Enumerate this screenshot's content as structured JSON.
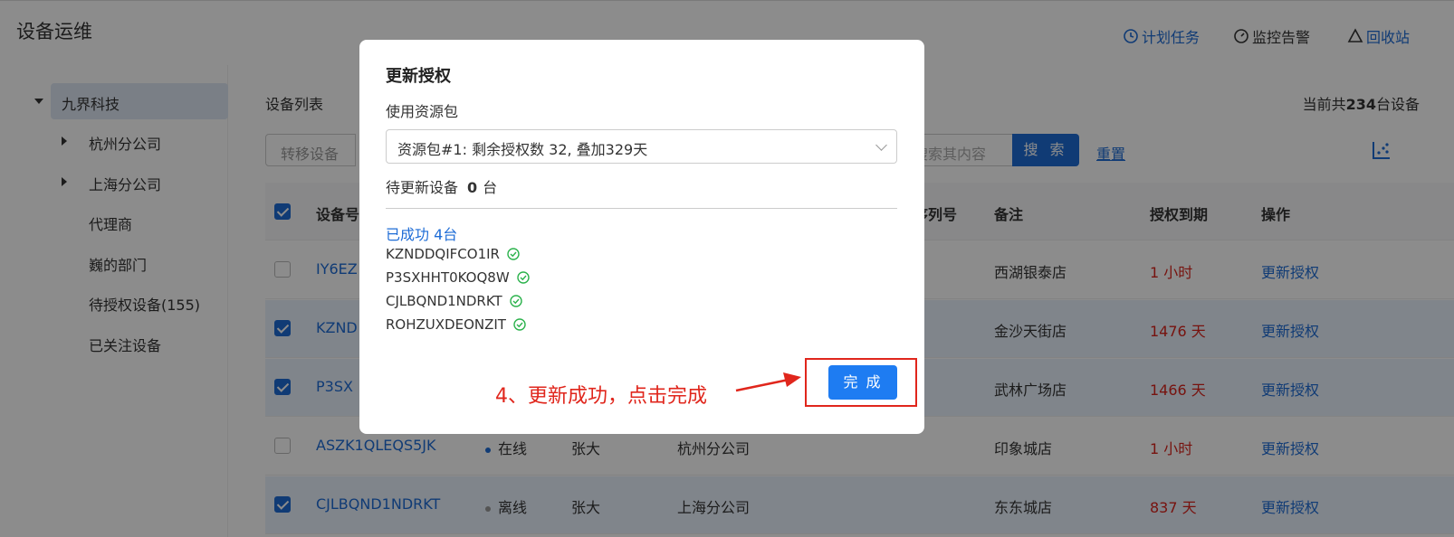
{
  "app": {
    "title": "设备运维",
    "links": [
      {
        "label": "计划任务",
        "icon": "clock-icon"
      },
      {
        "label": "监控告警",
        "icon": "gauge-icon"
      },
      {
        "label": "回收站",
        "icon": "recycle-icon"
      }
    ]
  },
  "sidebar": {
    "root": "九界科技",
    "items": [
      "杭州分公司",
      "上海分公司",
      "代理商",
      "巍的部门",
      "待授权设备(155)",
      "已关注设备"
    ]
  },
  "main": {
    "list_title": "设备列表",
    "total_prefix": "当前共",
    "total_count": "234",
    "total_suffix": "台设备",
    "search_left_placeholder": "转移设备",
    "search_right_placeholder": "牛搜索其内容",
    "search_button": "搜 索",
    "reset_link": "重置",
    "columns": {
      "device": "设备号",
      "serial": "仪序列号",
      "note": "备注",
      "expiry": "授权到期",
      "action": "操作"
    },
    "rows": [
      {
        "device": "IY6EZ",
        "status": "",
        "owner": "",
        "org": "",
        "note": "西湖银泰店",
        "expiry": "1 小时",
        "action": "更新授权",
        "checked": false
      },
      {
        "device": "KZND",
        "status": "",
        "owner": "",
        "org": "",
        "note": "金沙天街店",
        "expiry": "1476 天",
        "action": "更新授权",
        "checked": true
      },
      {
        "device": "P3SX",
        "status": "",
        "owner": "",
        "org": "",
        "note": "武林广场店",
        "expiry": "1466 天",
        "action": "更新授权",
        "checked": true
      },
      {
        "device": "ASZK1QLEQS5JK",
        "status": "在线",
        "status_color": "#1e6cd6",
        "owner": "张大",
        "org": "杭州分公司",
        "note": "印象城店",
        "expiry": "1 小时",
        "action": "更新授权",
        "checked": false
      },
      {
        "device": "CJLBQND1NDRKT",
        "status": "离线",
        "status_color": "#999999",
        "owner": "张大",
        "org": "上海分公司",
        "note": "东东城店",
        "expiry": "837 天",
        "action": "更新授权",
        "checked": true
      }
    ]
  },
  "modal": {
    "title": "更新授权",
    "resource_label": "使用资源包",
    "resource_value": "资源包#1: 剩余授权数 32, 叠加329天",
    "pending_prefix": "待更新设备",
    "pending_count": "0",
    "pending_suffix": "台",
    "success_title": "已成功 4台",
    "devices": [
      "KZNDDQIFCO1IR",
      "P3SXHHT0KOQ8W",
      "CJLBQND1NDRKT",
      "ROHZUXDEONZIT"
    ],
    "done_button": "完 成",
    "annotation": "4、更新成功，点击完成"
  },
  "colors": {
    "accent": "#1e6cd6",
    "annotation": "#e0261c",
    "success": "#2bb24c",
    "overdue": "#d9241c"
  }
}
